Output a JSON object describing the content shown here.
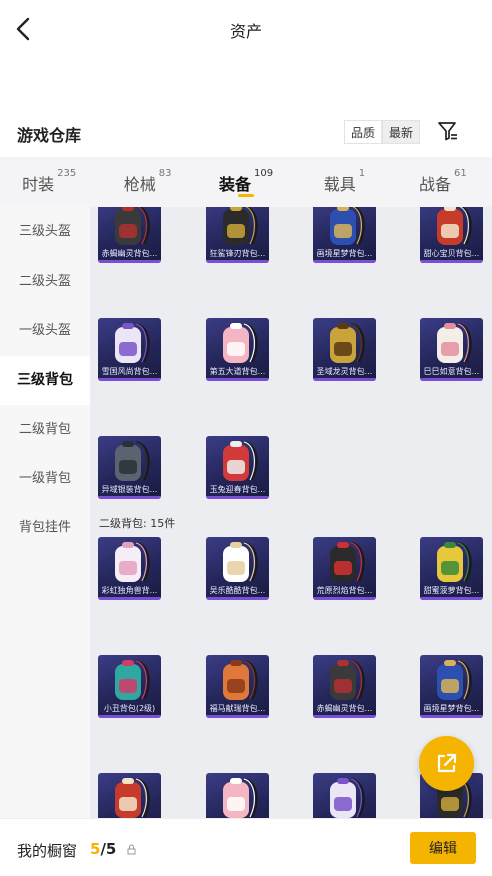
{
  "header": {
    "title": "资产"
  },
  "warehouse": {
    "title": "游戏仓库",
    "sort_quality": "品质",
    "sort_latest": "最新"
  },
  "tabs": [
    {
      "label": "时装",
      "count": "235"
    },
    {
      "label": "枪械",
      "count": "83"
    },
    {
      "label": "装备",
      "count": "109"
    },
    {
      "label": "载具",
      "count": "1"
    },
    {
      "label": "战备",
      "count": "61"
    }
  ],
  "side_nav": [
    {
      "label": "三级头盔"
    },
    {
      "label": "二级头盔"
    },
    {
      "label": "一级头盔"
    },
    {
      "label": "三级背包"
    },
    {
      "label": "二级背包"
    },
    {
      "label": "一级背包"
    },
    {
      "label": "背包挂件"
    }
  ],
  "level3_items": [
    {
      "name": "赤蝎幽灵背包...",
      "icon": "dark-red-backpack"
    },
    {
      "name": "狂鲨锋刃背包...",
      "icon": "shark-backpack"
    },
    {
      "name": "画境星梦背包...",
      "icon": "blue-gold-backpack"
    },
    {
      "name": "甜心宝贝背包...",
      "icon": "red-cake-backpack"
    },
    {
      "name": "雪国风尚背包...",
      "icon": "purple-snow-backpack"
    },
    {
      "name": "第五大道背包...",
      "icon": "pink-backpack"
    },
    {
      "name": "圣域龙灵背包...",
      "icon": "gold-dragon-backpack"
    },
    {
      "name": "巳巳如意背包...",
      "icon": "white-pink-backpack"
    },
    {
      "name": "异域银装背包...",
      "icon": "grey-tech-backpack"
    },
    {
      "name": "玉兔迎春背包...",
      "icon": "red-white-backpack"
    }
  ],
  "level2_section": {
    "label": "二级背包: 15件"
  },
  "level2_items": [
    {
      "name": "彩虹独角兽背...",
      "icon": "unicorn-backpack"
    },
    {
      "name": "吴乐酷酷背包...",
      "icon": "white-round-backpack"
    },
    {
      "name": "荒原烈焰背包...",
      "icon": "flame-backpack"
    },
    {
      "name": "甜蜜菠萝背包...",
      "icon": "pineapple-backpack"
    },
    {
      "name": "小丑背包(2级)",
      "icon": "clown-backpack"
    },
    {
      "name": "福马献瑞背包...",
      "icon": "orange-horse-backpack"
    },
    {
      "name": "赤蝎幽灵背包...",
      "icon": "dark-red-backpack"
    },
    {
      "name": "画境星梦背包...",
      "icon": "blue-gold-backpack"
    },
    {
      "name": "",
      "icon": "red-cake-backpack"
    },
    {
      "name": "",
      "icon": "pink-backpack"
    },
    {
      "name": "",
      "icon": "purple-snow-backpack"
    },
    {
      "name": "",
      "icon": "shark-backpack"
    }
  ],
  "bottom_bar": {
    "label": "我的橱窗",
    "current": "5",
    "separator": "/",
    "total": "5",
    "edit_label": "编辑"
  },
  "colors": {
    "accent": "#f5b400",
    "item_bg": "#2a2c66",
    "item_bar": "#7a4fd6"
  }
}
